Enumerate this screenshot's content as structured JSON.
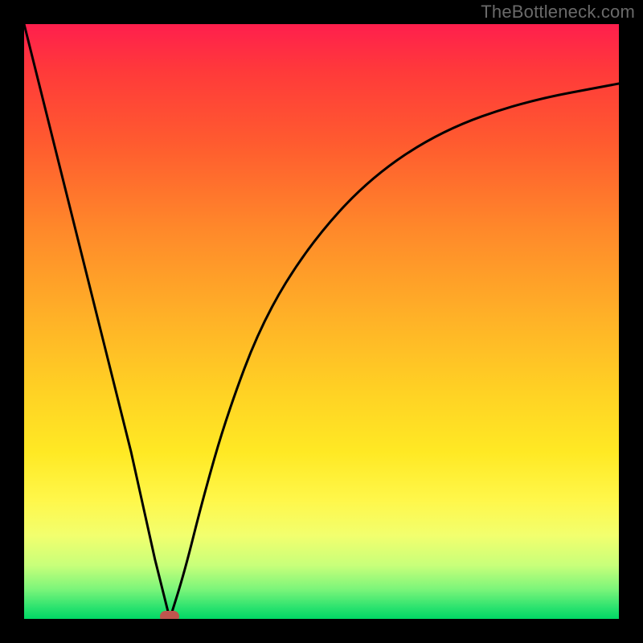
{
  "watermark": "TheBottleneck.com",
  "chart_data": {
    "type": "line",
    "title": "",
    "xlabel": "",
    "ylabel": "",
    "xlim": [
      0,
      100
    ],
    "ylim": [
      0,
      100
    ],
    "grid": false,
    "legend": false,
    "background_gradient": [
      "#ff1f4d",
      "#ff8a2a",
      "#ffe924",
      "#00d865"
    ],
    "series": [
      {
        "name": "left-branch",
        "x": [
          0,
          6,
          12,
          18,
          22,
          24.5
        ],
        "y": [
          100,
          76,
          52,
          28,
          10,
          0
        ]
      },
      {
        "name": "right-branch",
        "x": [
          24.5,
          27,
          30,
          34,
          40,
          48,
          58,
          70,
          84,
          100
        ],
        "y": [
          0,
          8,
          20,
          34,
          50,
          63,
          74,
          82,
          87,
          90
        ]
      }
    ],
    "marker_point": {
      "x": 24.5,
      "y": 0
    }
  },
  "colors": {
    "frame": "#000000",
    "curve": "#000000",
    "marker": "#c0554e",
    "watermark": "#6a6a6a"
  }
}
